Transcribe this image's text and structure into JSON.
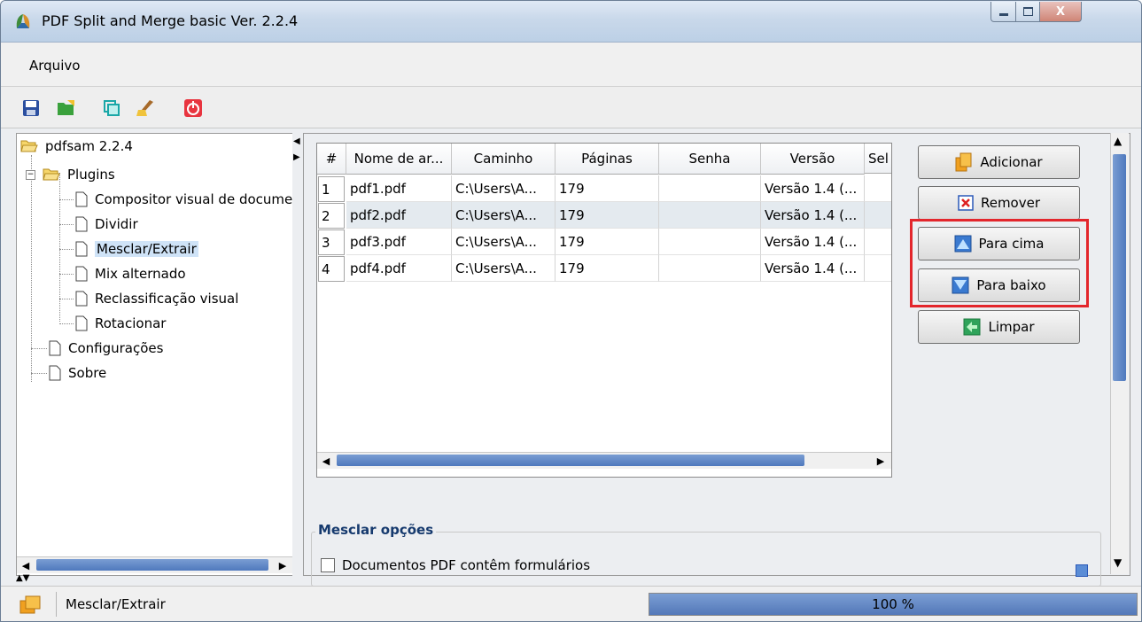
{
  "window": {
    "title": "PDF Split and Merge basic Ver. 2.2.4",
    "controls": {
      "minimize": "minimize",
      "maximize": "maximize",
      "close": "X"
    }
  },
  "menu": {
    "items": [
      {
        "label": "Arquivo"
      }
    ]
  },
  "toolbar": {
    "icons": [
      "save-icon",
      "open-icon",
      "environment-icon",
      "clear-icon",
      "exit-icon"
    ]
  },
  "tree": {
    "root": "pdfsam 2.2.4",
    "plugins": "Plugins",
    "plugin_items": [
      "Compositor visual de documentos",
      "Dividir",
      "Mesclar/Extrair",
      "Mix alternado",
      "Reclassificação visual",
      "Rotacionar"
    ],
    "selected": "Mesclar/Extrair",
    "configuracoes": "Configurações",
    "sobre": "Sobre"
  },
  "table": {
    "columns": [
      "#",
      "Nome de ar...",
      "Caminho",
      "Páginas",
      "Senha",
      "Versão",
      "Sel"
    ],
    "rows": [
      {
        "num": "1",
        "name": "pdf1.pdf",
        "path": "C:\\Users\\A...",
        "pages": "179",
        "password": "",
        "version": "Versão 1.4 (..."
      },
      {
        "num": "2",
        "name": "pdf2.pdf",
        "path": "C:\\Users\\A...",
        "pages": "179",
        "password": "",
        "version": "Versão 1.4 (..."
      },
      {
        "num": "3",
        "name": "pdf3.pdf",
        "path": "C:\\Users\\A...",
        "pages": "179",
        "password": "",
        "version": "Versão 1.4 (..."
      },
      {
        "num": "4",
        "name": "pdf4.pdf",
        "path": "C:\\Users\\A...",
        "pages": "179",
        "password": "",
        "version": "Versão 1.4 (..."
      }
    ]
  },
  "buttons": {
    "adicionar": "Adicionar",
    "remover": "Remover",
    "para_cima": "Para cima",
    "para_baixo": "Para baixo",
    "limpar": "Limpar"
  },
  "options": {
    "group_title": "Mesclar opções",
    "checkbox_forms": "Documentos PDF contêm formulários"
  },
  "status": {
    "text": "Mesclar/Extrair",
    "progress_percent": 100,
    "progress_label": "100 %"
  },
  "colors": {
    "accent": "#5378b8",
    "highlight_border": "#e3262c"
  }
}
